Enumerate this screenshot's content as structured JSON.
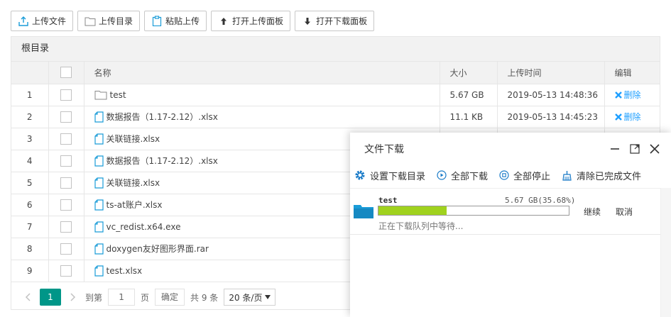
{
  "toolbar": {
    "upload_file": "上传文件",
    "upload_dir": "上传目录",
    "paste_upload": "粘贴上传",
    "open_upload_panel": "打开上传面板",
    "open_download_panel": "打开下载面板"
  },
  "breadcrumb": "根目录",
  "table": {
    "headers": {
      "name": "名称",
      "size": "大小",
      "time": "上传时间",
      "edit": "编辑"
    },
    "rows": [
      {
        "no": "1",
        "name": "test",
        "type": "folder",
        "size": "5.67 GB",
        "time": "2019-05-13 14:48:36",
        "action": "删除"
      },
      {
        "no": "2",
        "name": "数据报告（1.17-2.12）.xlsx",
        "type": "file",
        "size": "11.1 KB",
        "time": "2019-05-13 14:45:23",
        "action": "删除"
      },
      {
        "no": "3",
        "name": "关联链接.xlsx",
        "type": "file"
      },
      {
        "no": "4",
        "name": "数据报告（1.17-2.12）.xlsx",
        "type": "file"
      },
      {
        "no": "5",
        "name": "关联链接.xlsx",
        "type": "file"
      },
      {
        "no": "6",
        "name": "ts-at账户.xlsx",
        "type": "file"
      },
      {
        "no": "7",
        "name": "vc_redist.x64.exe",
        "type": "file"
      },
      {
        "no": "8",
        "name": "doxygen友好图形界面.rar",
        "type": "file"
      },
      {
        "no": "9",
        "name": "test.xlsx",
        "type": "file"
      }
    ]
  },
  "pager": {
    "current": "1",
    "goto_label": "到第",
    "goto_value": "1",
    "page_unit": "页",
    "confirm": "确定",
    "total": "共 9 条",
    "per_page": "20 条/页"
  },
  "download_panel": {
    "title": "文件下载",
    "tools": {
      "set_dir": "设置下载目录",
      "download_all": "全部下载",
      "stop_all": "全部停止",
      "clear_done": "清除已完成文件"
    },
    "item": {
      "name": "test",
      "size_text": "5.67 GB(35.68%)",
      "progress": 0.3568,
      "resume": "继续",
      "cancel": "取消",
      "status": "正在下载队列中等待..."
    }
  },
  "colors": {
    "accent": "#1E9FFF",
    "pager_active": "#009688",
    "progress": "#a0d21e",
    "folder": "#1a9cd8"
  }
}
